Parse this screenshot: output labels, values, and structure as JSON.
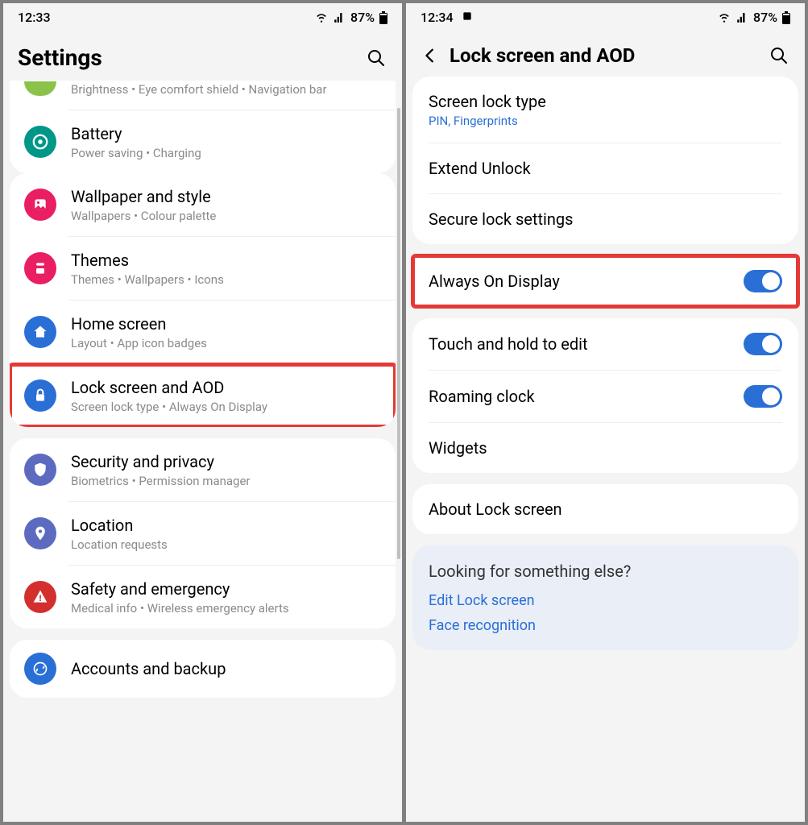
{
  "left": {
    "status": {
      "time": "12:33",
      "battery": "87%"
    },
    "header": {
      "title": "Settings"
    },
    "items": [
      {
        "title": "",
        "sub": "Brightness  •  Eye comfort shield  •  Navigation bar",
        "icon": "display-icon",
        "color": "#8bc34a"
      },
      {
        "title": "Battery",
        "sub": "Power saving  •  Charging",
        "icon": "battery-icon",
        "color": "#009688"
      },
      {
        "title": "Wallpaper and style",
        "sub": "Wallpapers  •  Colour palette",
        "icon": "wallpaper-icon",
        "color": "#e91e63"
      },
      {
        "title": "Themes",
        "sub": "Themes  •  Wallpapers  •  Icons",
        "icon": "themes-icon",
        "color": "#e91e63"
      },
      {
        "title": "Home screen",
        "sub": "Layout  •  App icon badges",
        "icon": "home-icon",
        "color": "#2a6fd6"
      },
      {
        "title": "Lock screen and AOD",
        "sub": "Screen lock type  •  Always On Display",
        "icon": "lock-icon",
        "color": "#2a6fd6"
      },
      {
        "title": "Security and privacy",
        "sub": "Biometrics  •  Permission manager",
        "icon": "shield-icon",
        "color": "#5c6bc0"
      },
      {
        "title": "Location",
        "sub": "Location requests",
        "icon": "location-icon",
        "color": "#5c6bc0"
      },
      {
        "title": "Safety and emergency",
        "sub": "Medical info  •  Wireless emergency alerts",
        "icon": "emergency-icon",
        "color": "#d32f2f"
      },
      {
        "title": "Accounts and backup",
        "sub": "",
        "icon": "accounts-icon",
        "color": "#2a6fd6"
      }
    ]
  },
  "right": {
    "status": {
      "time": "12:34",
      "battery": "87%"
    },
    "header": {
      "title": "Lock screen and AOD"
    },
    "group1": [
      {
        "title": "Screen lock type",
        "sub": "PIN, Fingerprints",
        "sublink": true
      },
      {
        "title": "Extend Unlock"
      },
      {
        "title": "Secure lock settings"
      }
    ],
    "aod": {
      "title": "Always On Display",
      "on": true
    },
    "group2": [
      {
        "title": "Touch and hold to edit",
        "toggle": true,
        "on": true
      },
      {
        "title": "Roaming clock",
        "toggle": true,
        "on": true
      },
      {
        "title": "Widgets"
      }
    ],
    "about": {
      "title": "About Lock screen"
    },
    "tips": {
      "title": "Looking for something else?",
      "links": [
        "Edit Lock screen",
        "Face recognition"
      ]
    }
  }
}
